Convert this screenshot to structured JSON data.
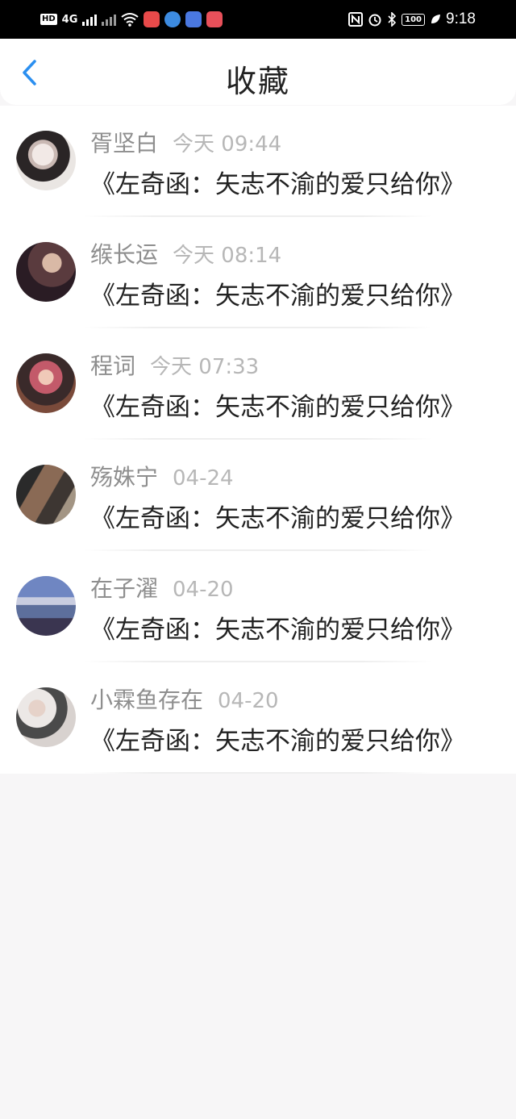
{
  "status_bar": {
    "left": {
      "hd": "HD",
      "net": "4G"
    },
    "right": {
      "battery": "100",
      "time": "9:18"
    }
  },
  "header": {
    "title": "收藏"
  },
  "items": [
    {
      "name": "胥坚白",
      "time": "今天 09:44",
      "message": "《左奇函：矢志不渝的爱只给你》"
    },
    {
      "name": "缑长运",
      "time": "今天 08:14",
      "message": "《左奇函：矢志不渝的爱只给你》"
    },
    {
      "name": "程词",
      "time": "今天 07:33",
      "message": "《左奇函：矢志不渝的爱只给你》"
    },
    {
      "name": "殇姝宁",
      "time": "04-24",
      "message": "《左奇函：矢志不渝的爱只给你》"
    },
    {
      "name": "在子濯",
      "time": "04-20",
      "message": "《左奇函：矢志不渝的爱只给你》"
    },
    {
      "name": "小霖鱼存在",
      "time": "04-20",
      "message": "《左奇函：矢志不渝的爱只给你》"
    }
  ],
  "colors": {
    "accent": "#2b8ff0",
    "background": "#f7f6f7"
  }
}
